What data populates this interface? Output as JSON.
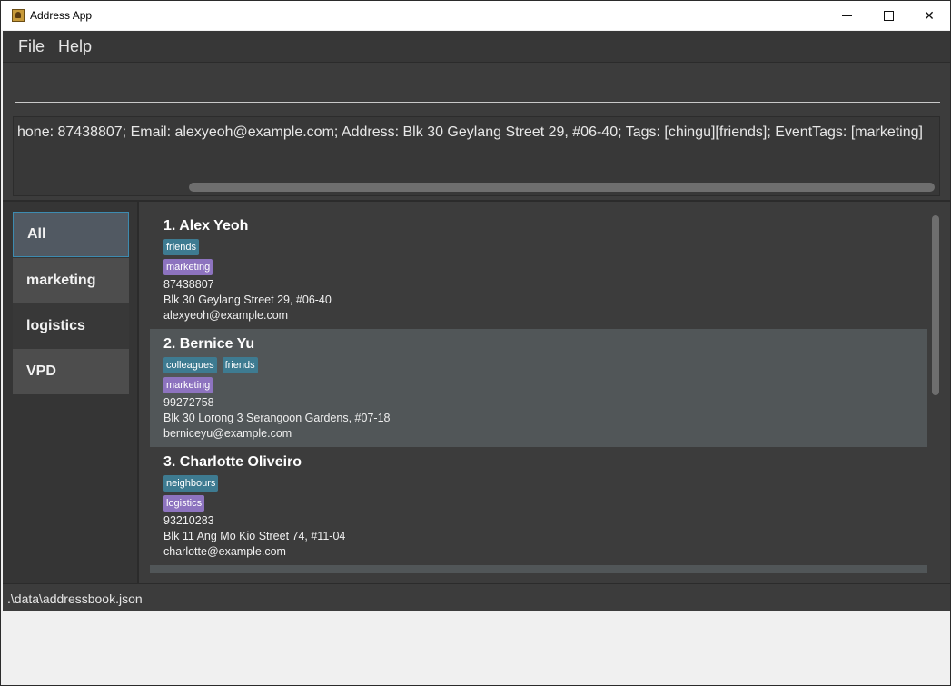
{
  "window": {
    "title": "Address App"
  },
  "menu": {
    "file": "File",
    "help": "Help"
  },
  "command": {
    "value": "",
    "placeholder": ""
  },
  "result": {
    "text": "hone: 87438807; Email: alexyeoh@example.com; Address: Blk 30 Geylang Street 29, #06-40; Tags: [chingu][friends]; EventTags: [marketing]"
  },
  "sidebar": {
    "items": [
      {
        "label": "All",
        "selected": true
      },
      {
        "label": "marketing",
        "selected": false
      },
      {
        "label": "logistics",
        "selected": false
      },
      {
        "label": "VPD",
        "selected": false
      }
    ]
  },
  "persons": [
    {
      "name": "1.  Alex Yeoh",
      "tags": [
        "friends"
      ],
      "event_tags": [
        "marketing"
      ],
      "phone": "87438807",
      "address": "Blk 30 Geylang Street 29, #06-40",
      "email": "alexyeoh@example.com"
    },
    {
      "name": "2.  Bernice Yu",
      "tags": [
        "colleagues",
        "friends"
      ],
      "event_tags": [
        "marketing"
      ],
      "phone": "99272758",
      "address": "Blk 30 Lorong 3 Serangoon Gardens, #07-18",
      "email": "berniceyu@example.com"
    },
    {
      "name": "3.  Charlotte Oliveiro",
      "tags": [
        "neighbours"
      ],
      "event_tags": [
        "logistics"
      ],
      "phone": "93210283",
      "address": "Blk 11 Ang Mo Kio Street 74, #11-04",
      "email": "charlotte@example.com"
    }
  ],
  "status": {
    "path": ".\\data\\addressbook.json"
  },
  "colors": {
    "background": "#3c3c3c",
    "selected_card": "#515658",
    "tag": "#3e7b91",
    "event_tag": "#8d73bf",
    "selected_border": "#3d8bb0"
  }
}
